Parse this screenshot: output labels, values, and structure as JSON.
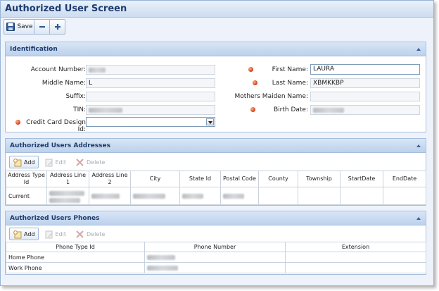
{
  "window": {
    "title": "Authorized User Screen"
  },
  "toolbar": {
    "save_label": "Save",
    "save_icon": "floppy-disk-icon",
    "minus_icon": "minus-icon",
    "plus_icon": "plus-icon"
  },
  "identification": {
    "title": "Identification",
    "fields": {
      "account_number": {
        "label": "Account Number:",
        "value": ""
      },
      "middle_name": {
        "label": "Middle Name:",
        "value": "L"
      },
      "suffix": {
        "label": "Suffix:",
        "value": ""
      },
      "tin": {
        "label": "TIN:",
        "value": ""
      },
      "credit_card_design_id": {
        "label": "Credit Card Design Id:",
        "value": ""
      },
      "first_name": {
        "label": "First Name:",
        "value": "LAURA"
      },
      "last_name": {
        "label": "Last Name:",
        "value": "XBMKKBP"
      },
      "mothers_maiden_name": {
        "label": "Mothers Maiden Name:",
        "value": ""
      },
      "birth_date": {
        "label": "Birth Date:",
        "value": ""
      }
    }
  },
  "addresses": {
    "title": "Authorized Users Addresses",
    "buttons": {
      "add": "Add",
      "edit": "Edit",
      "delete": "Delete"
    },
    "columns": [
      "Address Type Id",
      "Address Line 1",
      "Address Line 2",
      "City",
      "State Id",
      "Postal Code",
      "County",
      "Township",
      "StartDate",
      "EndDate"
    ],
    "rows": [
      {
        "address_type_id": "Current"
      }
    ]
  },
  "phones": {
    "title": "Authorized Users Phones",
    "buttons": {
      "add": "Add",
      "edit": "Edit",
      "delete": "Delete"
    },
    "columns": [
      "Phone Type Id",
      "Phone Number",
      "Extension"
    ],
    "rows": [
      {
        "phone_type_id": "Home Phone",
        "extension": ""
      },
      {
        "phone_type_id": "Work Phone",
        "extension": ""
      }
    ]
  },
  "colors": {
    "header_text": "#1e3d6e",
    "required_marker": "#d4421a",
    "panel_border": "#a6bedd"
  }
}
